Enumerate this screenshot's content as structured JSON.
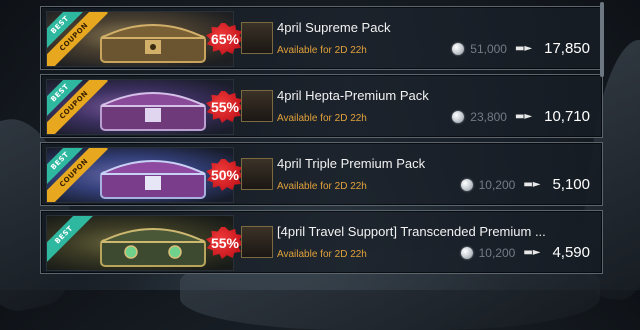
{
  "packs": [
    {
      "badges": [
        "BEST",
        "COUPON"
      ],
      "discount": "65%",
      "title": "4pril Supreme Pack",
      "availability": "Available for 2D 22h",
      "old_price": "51,000",
      "new_price": "17,850",
      "theme": "gold"
    },
    {
      "badges": [
        "BEST",
        "COUPON"
      ],
      "discount": "55%",
      "title": "4pril Hepta-Premium Pack",
      "availability": "Available for 2D 22h",
      "old_price": "23,800",
      "new_price": "10,710",
      "theme": "purple"
    },
    {
      "badges": [
        "BEST",
        "COUPON"
      ],
      "discount": "50%",
      "title": "4pril Triple Premium Pack",
      "availability": "Available for 2D 22h",
      "old_price": "10,200",
      "new_price": "5,100",
      "theme": "blue"
    },
    {
      "badges": [
        "BEST"
      ],
      "discount": "55%",
      "title": "[4pril Travel Support] Transcended Premium ...",
      "availability": "Available for 2D 22h",
      "old_price": "10,200",
      "new_price": "4,590",
      "theme": "green"
    }
  ],
  "price_arrow_icon": "right-arrow-icon",
  "currency_icon": "silver-coin-icon",
  "colors": {
    "discount_badge": "#d6191f",
    "best_ribbon": "#2fb8a0",
    "coupon_ribbon": "#e7a81f",
    "availability_text": "#e1a13a"
  }
}
